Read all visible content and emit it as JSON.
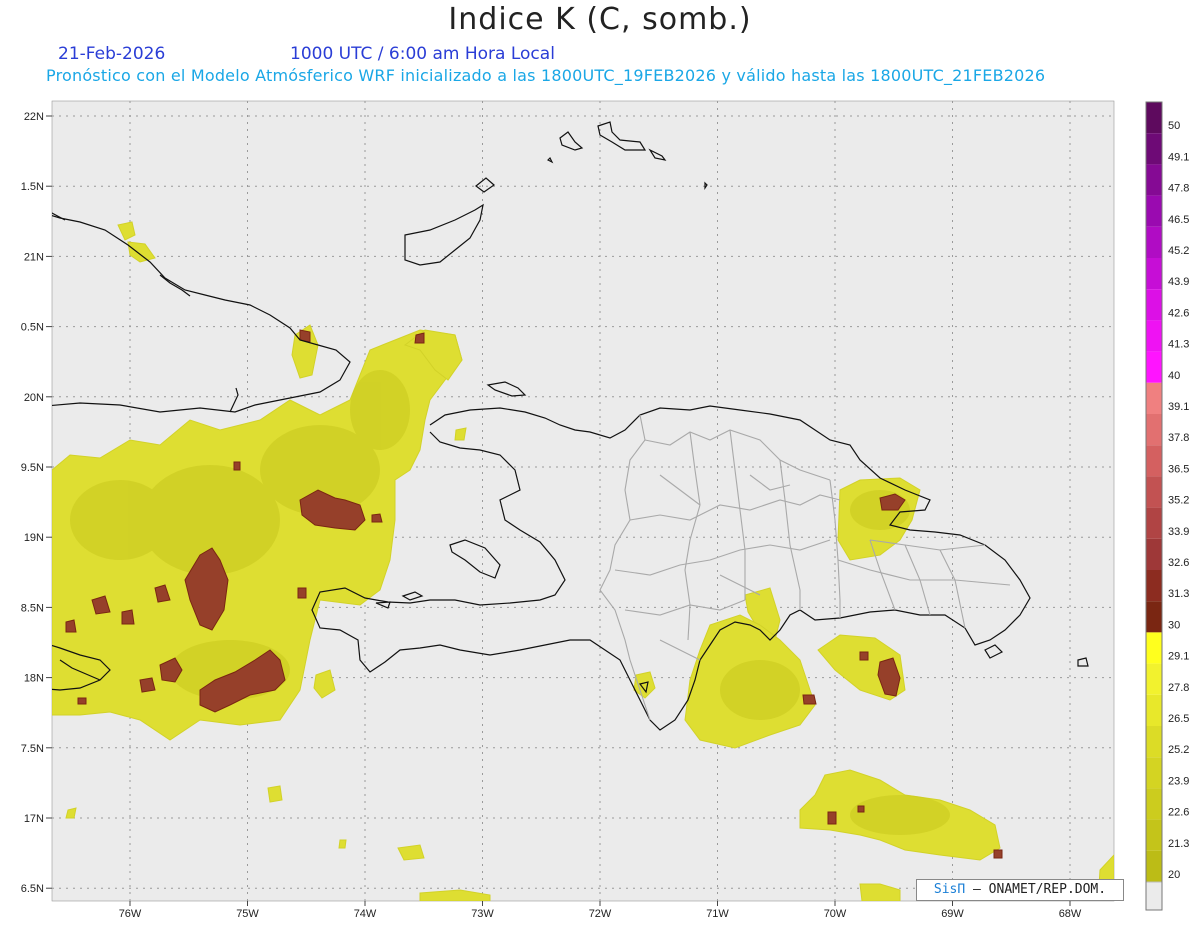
{
  "header": {
    "title": "Indice K (C, somb.)",
    "date": "21-Feb-2026",
    "valid_time": "1000 UTC / 6:00 am Hora Local",
    "forecast_info": "Pronóstico con el Modelo Atmósferico WRF inicializado a las 1800UTC_19FEB2026 y válido hasta las  1800UTC_21FEB2026"
  },
  "map": {
    "lat_labels": [
      "22N",
      "1.5N",
      "21N",
      "0.5N",
      "20N",
      "9.5N",
      "19N",
      "8.5N",
      "18N",
      "7.5N",
      "17N",
      "6.5N"
    ],
    "lon_labels": [
      "76W",
      "75W",
      "74W",
      "73W",
      "72W",
      "71W",
      "70W",
      "69W",
      "68W"
    ],
    "background_color": "#ebebeb",
    "coast_color": "#000000",
    "province_color": "#aaaaaa"
  },
  "colorbar": {
    "levels": [
      "50",
      "49.1",
      "47.8",
      "46.5",
      "45.2",
      "43.9",
      "42.6",
      "41.3",
      "40",
      "39.1",
      "37.8",
      "36.5",
      "35.2",
      "33.9",
      "32.6",
      "31.3",
      "30",
      "29.1",
      "27.8",
      "26.5",
      "25.2",
      "23.9",
      "22.6",
      "21.3",
      "20"
    ],
    "colors": [
      "#5e0a5e",
      "#6e0a76",
      "#850a94",
      "#9a0ab0",
      "#b00cc4",
      "#c60ed6",
      "#dc10e6",
      "#ef12f3",
      "#ff14ff",
      "#f08080",
      "#e27070",
      "#d46060",
      "#c25252",
      "#b04444",
      "#9e3838",
      "#8c2c20",
      "#7a2612",
      "#ffff1e",
      "#f2f22e",
      "#e8e82a",
      "#dcdc26",
      "#d4d422",
      "#cccc1e",
      "#c4c41a",
      "#bcbc16"
    ],
    "below_color": "#ebebeb"
  },
  "credit": {
    "brand": "SisΠ",
    "text": " – ONAMET/REP.DOM."
  }
}
